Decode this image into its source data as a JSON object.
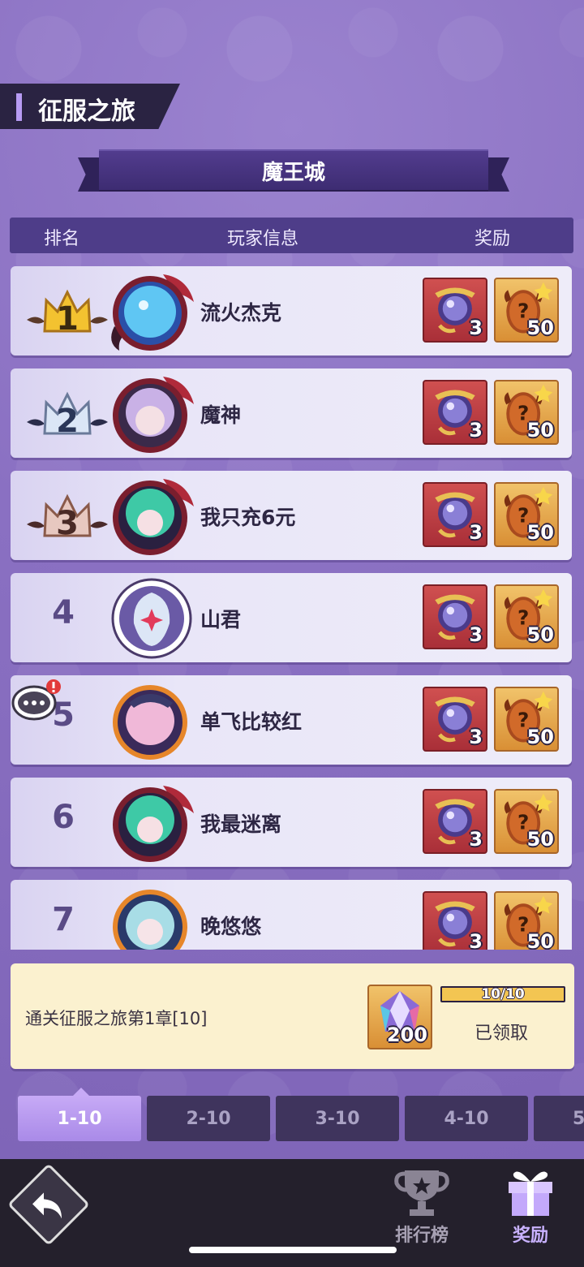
{
  "header": {
    "title": "征服之旅"
  },
  "banner": {
    "text": "魔王城"
  },
  "table": {
    "col_rank": "排名",
    "col_player": "玩家信息",
    "col_reward": "奖励"
  },
  "rows": [
    {
      "rank": "1",
      "name": "流火杰克",
      "reward1_qty": "3",
      "reward2_qty": "50"
    },
    {
      "rank": "2",
      "name": "魔神",
      "reward1_qty": "3",
      "reward2_qty": "50"
    },
    {
      "rank": "3",
      "name": "我只充6元",
      "reward1_qty": "3",
      "reward2_qty": "50"
    },
    {
      "rank": "4",
      "name": "山君",
      "reward1_qty": "3",
      "reward2_qty": "50"
    },
    {
      "rank": "5",
      "name": "单飞比较红",
      "reward1_qty": "3",
      "reward2_qty": "50"
    },
    {
      "rank": "6",
      "name": "我最迷离",
      "reward1_qty": "3",
      "reward2_qty": "50"
    },
    {
      "rank": "7",
      "name": "晚悠悠",
      "reward1_qty": "3",
      "reward2_qty": "50"
    }
  ],
  "quest": {
    "text": "通关征服之旅第1章[10]",
    "reward_qty": "200",
    "progress_text": "10/10",
    "progress_fraction": 1.0,
    "status": "已领取"
  },
  "tabs": [
    "1-10",
    "2-10",
    "3-10",
    "4-10",
    "5"
  ],
  "nav": {
    "ranking": "排行榜",
    "rewards": "奖励"
  },
  "colors": {
    "accent": "#a98ae8",
    "gold": "#f3c552",
    "crown1": "#f3c230",
    "crown2": "#dbe6f6",
    "crown3": "#e7c8c0"
  },
  "icons": {
    "back": "back-arrow-icon",
    "ranking": "trophy-icon",
    "rewards": "gift-icon",
    "chat": "chat-bubble-icon"
  }
}
